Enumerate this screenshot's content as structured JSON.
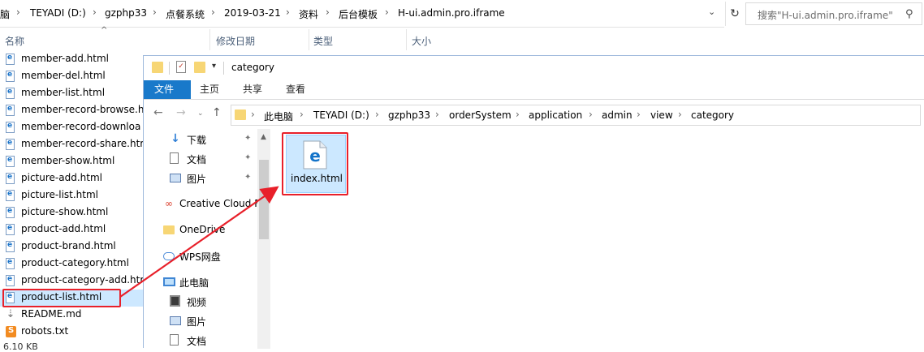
{
  "bg_window": {
    "breadcrumbs": [
      "脑",
      "TEYADI (D:)",
      "gzphp33",
      "点餐系统",
      "2019-03-21",
      "资料",
      "后台模板",
      "H-ui.admin.pro.iframe"
    ],
    "search_placeholder": "搜索\"H-ui.admin.pro.iframe\"",
    "columns": [
      "名称",
      "修改日期",
      "类型",
      "大小"
    ],
    "files": [
      {
        "name": "member-add.html",
        "icon": "html-file-icon"
      },
      {
        "name": "member-del.html",
        "icon": "html-file-icon"
      },
      {
        "name": "member-list.html",
        "icon": "html-file-icon"
      },
      {
        "name": "member-record-browse.h",
        "icon": "html-file-icon"
      },
      {
        "name": "member-record-downloa",
        "icon": "html-file-icon"
      },
      {
        "name": "member-record-share.htr",
        "icon": "html-file-icon"
      },
      {
        "name": "member-show.html",
        "icon": "html-file-icon"
      },
      {
        "name": "picture-add.html",
        "icon": "html-file-icon"
      },
      {
        "name": "picture-list.html",
        "icon": "html-file-icon"
      },
      {
        "name": "picture-show.html",
        "icon": "html-file-icon"
      },
      {
        "name": "product-add.html",
        "icon": "html-file-icon"
      },
      {
        "name": "product-brand.html",
        "icon": "html-file-icon"
      },
      {
        "name": "product-category.html",
        "icon": "html-file-icon"
      },
      {
        "name": "product-category-add.htr",
        "icon": "html-file-icon"
      },
      {
        "name": "product-list.html",
        "icon": "html-file-icon",
        "selected": true
      },
      {
        "name": "README.md",
        "icon": "markdown-file-icon"
      },
      {
        "name": "robots.txt",
        "icon": "sublime-file-icon"
      }
    ],
    "status": "6.10 KB"
  },
  "front_window": {
    "title": "category",
    "ribbon_tabs": [
      "文件",
      "主页",
      "共享",
      "查看"
    ],
    "breadcrumbs": [
      "此电脑",
      "TEYADI (D:)",
      "gzphp33",
      "orderSystem",
      "application",
      "admin",
      "view",
      "category"
    ],
    "nav_items": [
      {
        "label": "下载",
        "icon": "download-icon",
        "pinned": true,
        "level": 1
      },
      {
        "label": "文档",
        "icon": "document-icon",
        "pinned": true,
        "level": 1
      },
      {
        "label": "图片",
        "icon": "pictures-icon",
        "pinned": true,
        "level": 1
      },
      {
        "label": "Creative Cloud F",
        "icon": "creative-cloud-icon",
        "pinned": false,
        "level": 0
      },
      {
        "label": "OneDrive",
        "icon": "onedrive-folder-icon",
        "pinned": false,
        "level": 0
      },
      {
        "label": "WPS网盘",
        "icon": "wps-cloud-icon",
        "pinned": false,
        "level": 0
      },
      {
        "label": "此电脑",
        "icon": "this-pc-icon",
        "pinned": false,
        "level": 0
      },
      {
        "label": "视频",
        "icon": "video-icon",
        "pinned": false,
        "level": 1
      },
      {
        "label": "图片",
        "icon": "pictures-icon",
        "pinned": false,
        "level": 1
      },
      {
        "label": "文档",
        "icon": "document-icon",
        "pinned": false,
        "level": 1
      }
    ],
    "file": {
      "name": "index.html",
      "icon": "edge-html-icon"
    }
  },
  "annotation": {
    "color": "#e8202a",
    "arrow": "from product-list.html to index.html"
  }
}
